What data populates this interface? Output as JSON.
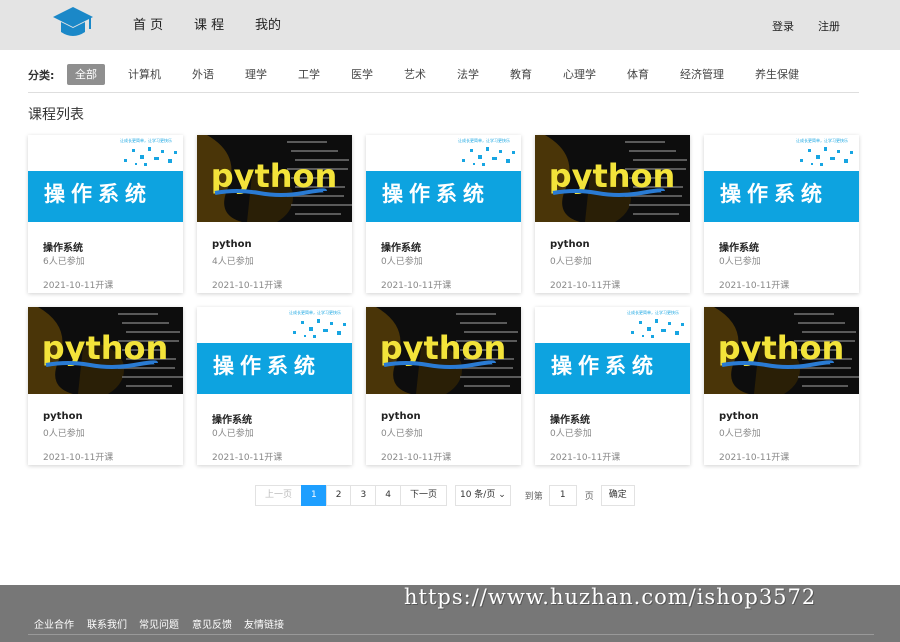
{
  "header": {
    "nav": [
      "首 页",
      "课 程",
      "我的"
    ],
    "login": "登录",
    "register": "注册"
  },
  "categories": {
    "label": "分类:",
    "items": [
      "全部",
      "计算机",
      "外语",
      "理学",
      "工学",
      "医学",
      "艺术",
      "法学",
      "教育",
      "心理学",
      "体育",
      "经济管理",
      "养生保健"
    ]
  },
  "section_title": "课程列表",
  "thumb": {
    "os_caption": "操作系统",
    "os_tagline": "让成长更简单，让学习更快乐",
    "python_text": "python"
  },
  "courses": [
    {
      "title": "操作系统",
      "joined": "6人已参加",
      "date": "2021-10-11开课",
      "kind": "os"
    },
    {
      "title": "python",
      "joined": "4人已参加",
      "date": "2021-10-11开课",
      "kind": "python"
    },
    {
      "title": "操作系统",
      "joined": "0人已参加",
      "date": "2021-10-11开课",
      "kind": "os"
    },
    {
      "title": "python",
      "joined": "0人已参加",
      "date": "2021-10-11开课",
      "kind": "python"
    },
    {
      "title": "操作系统",
      "joined": "0人已参加",
      "date": "2021-10-11开课",
      "kind": "os"
    },
    {
      "title": "python",
      "joined": "0人已参加",
      "date": "2021-10-11开课",
      "kind": "python"
    },
    {
      "title": "操作系统",
      "joined": "0人已参加",
      "date": "2021-10-11开课",
      "kind": "os"
    },
    {
      "title": "python",
      "joined": "0人已参加",
      "date": "2021-10-11开课",
      "kind": "python"
    },
    {
      "title": "操作系统",
      "joined": "0人已参加",
      "date": "2021-10-11开课",
      "kind": "os"
    },
    {
      "title": "python",
      "joined": "0人已参加",
      "date": "2021-10-11开课",
      "kind": "python"
    }
  ],
  "pagination": {
    "prev": "上一页",
    "pages": [
      "1",
      "2",
      "3",
      "4"
    ],
    "current": "1",
    "next": "下一页",
    "page_size": "10 条/页",
    "goto_label": "到第",
    "goto_value": "1",
    "goto_unit": "页",
    "confirm": "确定"
  },
  "footer": {
    "links": [
      "企业合作",
      "联系我们",
      "常见问题",
      "意见反馈",
      "友情链接"
    ]
  },
  "watermark": "https://www.huzhan.com/ishop3572",
  "colors": {
    "accent": "#1e9fff",
    "logo": "#1b88c8",
    "os_banner": "#0da3e0",
    "python_yellow": "#f3e33a"
  }
}
